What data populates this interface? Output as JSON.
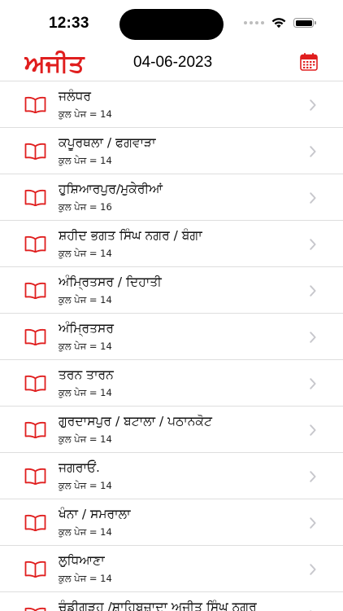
{
  "status_bar": {
    "time": "12:33"
  },
  "header": {
    "logo_text": "ਅਜੀਤ",
    "date": "04-06-2023",
    "calendar_icon": "calendar-icon"
  },
  "colors": {
    "accent": "#e01e1e",
    "chevron": "#c7c7cc",
    "separator": "#dedede"
  },
  "editions": [
    {
      "title": "ਜਲੰਧਰ",
      "pages": "ਕੁਲ ਪੇਜ = 14"
    },
    {
      "title": "ਕਪੂਰਥਲਾ / ਫਗਵਾੜਾ",
      "pages": "ਕੁਲ ਪੇਜ = 14"
    },
    {
      "title": "ਹੁਸ਼ਿਆਰਪੁਰ/ਮੁਕੇਰੀਆਂ",
      "pages": "ਕੁਲ ਪੇਜ = 16"
    },
    {
      "title": "ਸ਼ਹੀਦ ਭਗਤ ਸਿੰਘ ਨਗਰ / ਬੰਗਾ",
      "pages": "ਕੁਲ ਪੇਜ = 14"
    },
    {
      "title": "ਅੰਮ੍ਰਿਤਸਰ / ਦਿਹਾਤੀ",
      "pages": "ਕੁਲ ਪੇਜ = 14"
    },
    {
      "title": "ਅੰਮ੍ਰਿਤਸਰ",
      "pages": "ਕੁਲ ਪੇਜ = 14"
    },
    {
      "title": "ਤਰਨ ਤਾਰਨ",
      "pages": "ਕੁਲ ਪੇਜ = 14"
    },
    {
      "title": "ਗੁਰਦਾਸਪੁਰ / ਬਟਾਲਾ / ਪਠਾਨਕੋਟ",
      "pages": "ਕੁਲ ਪੇਜ = 14"
    },
    {
      "title": "ਜਗਰਾਓਂ.",
      "pages": "ਕੁਲ ਪੇਜ = 14"
    },
    {
      "title": "ਖੰਨਾ / ਸਮਰਾਲਾ",
      "pages": "ਕੁਲ ਪੇਜ = 14"
    },
    {
      "title": "ਲੁਧਿਆਣਾ",
      "pages": "ਕੁਲ ਪੇਜ = 14"
    },
    {
      "title": "ਚੰਡੀਗੜ੍ਹ /ਸ਼ਾਹਿਬਜ਼ਾਦਾ ਅਜੀਤ ਸਿੰਘ ਨਗਰ",
      "pages": ""
    }
  ]
}
